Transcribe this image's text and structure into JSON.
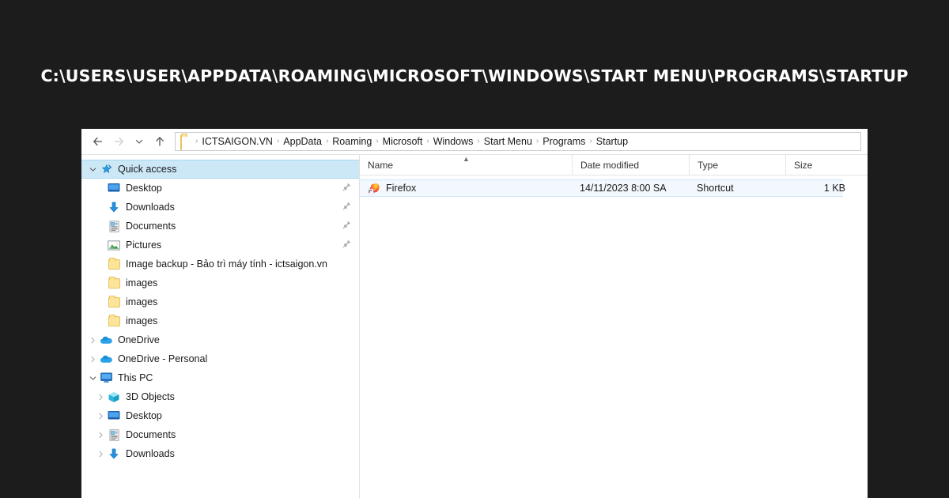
{
  "headline": "C:\\USERS\\USER\\APPDATA\\ROAMING\\MICROSOFT\\WINDOWS\\START MENU\\PROGRAMS\\STARTUP",
  "colors": {
    "page_background": "#1c1c1c",
    "headline_text": "#ffffff",
    "window_background": "#ffffff",
    "selection_blue": "#cce8f7",
    "selection_border": "#a9d9f2",
    "folder_yellow": "#fce49a",
    "accent_blue": "#0a84c8"
  },
  "toolbar": {
    "back_label": "Back",
    "forward_label": "Forward",
    "recent_label": "Recent locations",
    "up_label": "Up"
  },
  "breadcrumb": {
    "separator": "›",
    "items": [
      "ICTSAIGON.VN",
      "AppData",
      "Roaming",
      "Microsoft",
      "Windows",
      "Start Menu",
      "Programs",
      "Startup"
    ]
  },
  "sidebar": {
    "items": [
      {
        "label": "Quick access",
        "icon": "pin-star-icon",
        "indent": 0,
        "chevron": "down",
        "selected": true,
        "pinned": false
      },
      {
        "label": "Desktop",
        "icon": "desktop-icon",
        "indent": 1,
        "chevron": "none",
        "selected": false,
        "pinned": true
      },
      {
        "label": "Downloads",
        "icon": "download-icon",
        "indent": 1,
        "chevron": "none",
        "selected": false,
        "pinned": true
      },
      {
        "label": "Documents",
        "icon": "document-icon",
        "indent": 1,
        "chevron": "none",
        "selected": false,
        "pinned": true
      },
      {
        "label": "Pictures",
        "icon": "pictures-icon",
        "indent": 1,
        "chevron": "none",
        "selected": false,
        "pinned": true
      },
      {
        "label": "Image backup - Bảo trì máy tính - ictsaigon.vn",
        "icon": "folder-icon",
        "indent": 1,
        "chevron": "none",
        "selected": false,
        "pinned": false
      },
      {
        "label": "images",
        "icon": "folder-icon",
        "indent": 1,
        "chevron": "none",
        "selected": false,
        "pinned": false
      },
      {
        "label": "images",
        "icon": "folder-icon",
        "indent": 1,
        "chevron": "none",
        "selected": false,
        "pinned": false
      },
      {
        "label": "images",
        "icon": "folder-icon",
        "indent": 1,
        "chevron": "none",
        "selected": false,
        "pinned": false
      },
      {
        "label": "OneDrive",
        "icon": "onedrive-icon",
        "indent": 0,
        "chevron": "right",
        "selected": false,
        "pinned": false
      },
      {
        "label": "OneDrive - Personal",
        "icon": "onedrive-icon",
        "indent": 0,
        "chevron": "right",
        "selected": false,
        "pinned": false
      },
      {
        "label": "This PC",
        "icon": "thispc-icon",
        "indent": 0,
        "chevron": "down",
        "selected": false,
        "pinned": false
      },
      {
        "label": "3D Objects",
        "icon": "3dobjects-icon",
        "indent": 1,
        "chevron": "right",
        "selected": false,
        "pinned": false
      },
      {
        "label": "Desktop",
        "icon": "desktop-icon",
        "indent": 1,
        "chevron": "right",
        "selected": false,
        "pinned": false
      },
      {
        "label": "Documents",
        "icon": "document-icon",
        "indent": 1,
        "chevron": "right",
        "selected": false,
        "pinned": false
      },
      {
        "label": "Downloads",
        "icon": "download-icon",
        "indent": 1,
        "chevron": "right",
        "selected": false,
        "pinned": false
      }
    ]
  },
  "filelist": {
    "sort_column": "Name",
    "sort_direction": "ascending",
    "columns": [
      {
        "label": "Name",
        "align": "left"
      },
      {
        "label": "Date modified",
        "align": "left"
      },
      {
        "label": "Type",
        "align": "left"
      },
      {
        "label": "Size",
        "align": "right"
      }
    ],
    "rows": [
      {
        "name": "Firefox",
        "date_modified": "14/11/2023 8:00 SA",
        "type": "Shortcut",
        "size": "1 KB",
        "icon": "firefox-shortcut-icon",
        "selected": true
      }
    ]
  }
}
